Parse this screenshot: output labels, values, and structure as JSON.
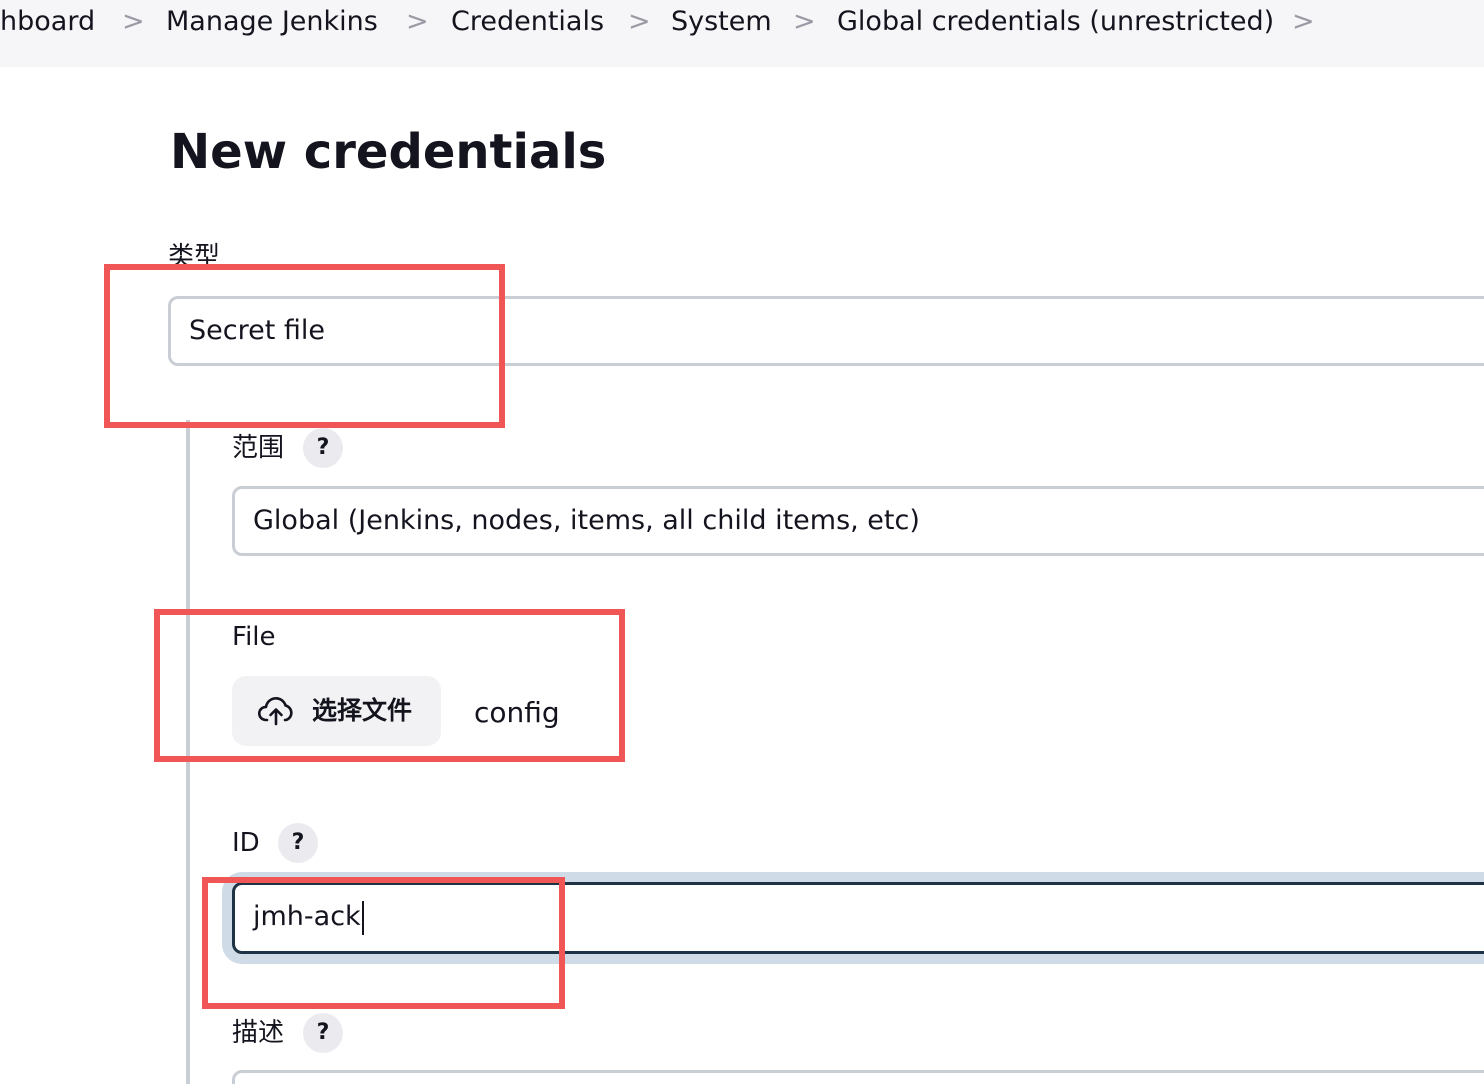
{
  "breadcrumb": {
    "items": [
      "hboard",
      "Manage Jenkins",
      "Credentials",
      "System",
      "Global credentials (unrestricted)"
    ],
    "separator": ">"
  },
  "page_title": "New credentials",
  "kind": {
    "label": "类型",
    "value": "Secret file"
  },
  "scope": {
    "label": "范围",
    "help": "?",
    "value": "Global (Jenkins, nodes, items, all child items, etc)"
  },
  "file": {
    "label": "File",
    "button_label": "选择文件",
    "chosen_file": "config",
    "icon": "cloud-upload-icon"
  },
  "id_field": {
    "label": "ID",
    "help": "?",
    "value": "jmh-ack"
  },
  "description": {
    "label": "描述",
    "help": "?",
    "value": ""
  },
  "colors": {
    "annotation": "#f05656",
    "focus_border": "#1e3346",
    "focus_ring": "#cfdbe6",
    "breadcrumb_bg": "#f6f6f8"
  }
}
